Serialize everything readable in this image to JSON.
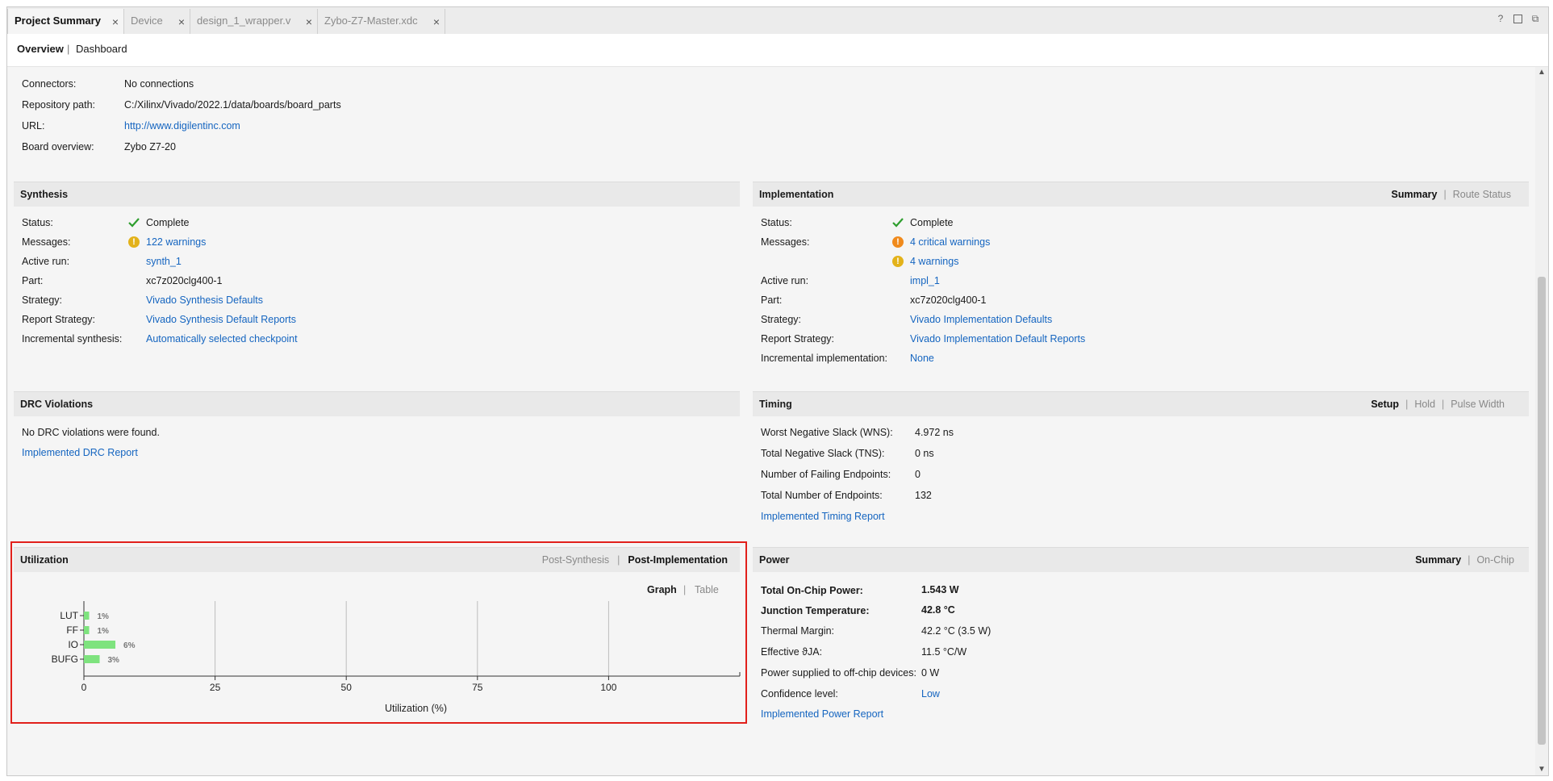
{
  "tabs": [
    {
      "label": "Project Summary",
      "active": true
    },
    {
      "label": "Device",
      "active": false
    },
    {
      "label": "design_1_wrapper.v",
      "active": false
    },
    {
      "label": "Zybo-Z7-Master.xdc",
      "active": false
    }
  ],
  "window_icons": [
    "help-icon",
    "restore-icon",
    "float-icon"
  ],
  "subnav": {
    "overview": "Overview",
    "sep": "|",
    "dashboard": "Dashboard"
  },
  "board": {
    "connectors_label": "Connectors:",
    "connectors_value": "No connections",
    "repo_label": "Repository path:",
    "repo_value": "C:/Xilinx/Vivado/2022.1/data/boards/board_parts",
    "url_label": "URL:",
    "url_value": "http://www.digilentinc.com",
    "overview_label": "Board overview:",
    "overview_value": "Zybo Z7-20"
  },
  "synthesis": {
    "title": "Synthesis",
    "status_label": "Status:",
    "status_value": "Complete",
    "messages_label": "Messages:",
    "messages_value": "122 warnings",
    "active_run_label": "Active run:",
    "active_run_value": "synth_1",
    "part_label": "Part:",
    "part_value": "xc7z020clg400-1",
    "strategy_label": "Strategy:",
    "strategy_value": "Vivado Synthesis Defaults",
    "report_label": "Report Strategy:",
    "report_value": "Vivado Synthesis Default Reports",
    "incr_label": "Incremental synthesis:",
    "incr_value": "Automatically selected checkpoint"
  },
  "implementation": {
    "title": "Implementation",
    "tab_summary": "Summary",
    "tab_route": "Route Status",
    "status_label": "Status:",
    "status_value": "Complete",
    "messages_label": "Messages:",
    "critical_value": "4 critical warnings",
    "warnings_value": "4 warnings",
    "active_run_label": "Active run:",
    "active_run_value": "impl_1",
    "part_label": "Part:",
    "part_value": "xc7z020clg400-1",
    "strategy_label": "Strategy:",
    "strategy_value": "Vivado Implementation Defaults",
    "report_label": "Report Strategy:",
    "report_value": "Vivado Implementation Default Reports",
    "incr_label": "Incremental implementation:",
    "incr_value": "None"
  },
  "drc": {
    "title": "DRC Violations",
    "message": "No DRC violations were found.",
    "report_link": "Implemented DRC Report"
  },
  "timing": {
    "title": "Timing",
    "tab_setup": "Setup",
    "tab_hold": "Hold",
    "tab_pulse": "Pulse Width",
    "wns_label": "Worst Negative Slack (WNS):",
    "wns_value": "4.972 ns",
    "tns_label": "Total Negative Slack (TNS):",
    "tns_value": "0 ns",
    "fail_label": "Number of Failing Endpoints:",
    "fail_value": "0",
    "total_label": "Total Number of Endpoints:",
    "total_value": "132",
    "report_link": "Implemented Timing Report"
  },
  "utilization": {
    "title": "Utilization",
    "tab_post_synth": "Post-Synthesis",
    "tab_post_impl": "Post-Implementation",
    "view_graph": "Graph",
    "view_table": "Table"
  },
  "power": {
    "title": "Power",
    "tab_summary": "Summary",
    "tab_onchip": "On-Chip",
    "total_label": "Total On-Chip Power:",
    "total_value": "1.543 W",
    "junction_label": "Junction Temperature:",
    "junction_value": "42.8 °C",
    "margin_label": "Thermal Margin:",
    "margin_value": "42.2 °C (3.5 W)",
    "theta_label": "Effective ϑJA:",
    "theta_value": "11.5 °C/W",
    "offchip_label": "Power supplied to off-chip devices:",
    "offchip_value": "0 W",
    "confidence_label": "Confidence level:",
    "confidence_value": "Low",
    "report_link": "Implemented Power Report"
  },
  "colors": {
    "link": "#1565c0",
    "bar": "#7ee37e",
    "ok": "#2e9e2e",
    "warn": "#e3b21a",
    "critical": "#f08a1c",
    "highlight": "#e1201b"
  },
  "chart_data": {
    "type": "bar",
    "orientation": "horizontal",
    "categories": [
      "LUT",
      "FF",
      "IO",
      "BUFG"
    ],
    "values": [
      1,
      1,
      6,
      3
    ],
    "value_labels": [
      "1%",
      "1%",
      "6%",
      "3%"
    ],
    "xlabel": "Utilization (%)",
    "xlim": [
      0,
      125
    ],
    "xticks": [
      0,
      25,
      50,
      75,
      100
    ],
    "grid": true
  }
}
